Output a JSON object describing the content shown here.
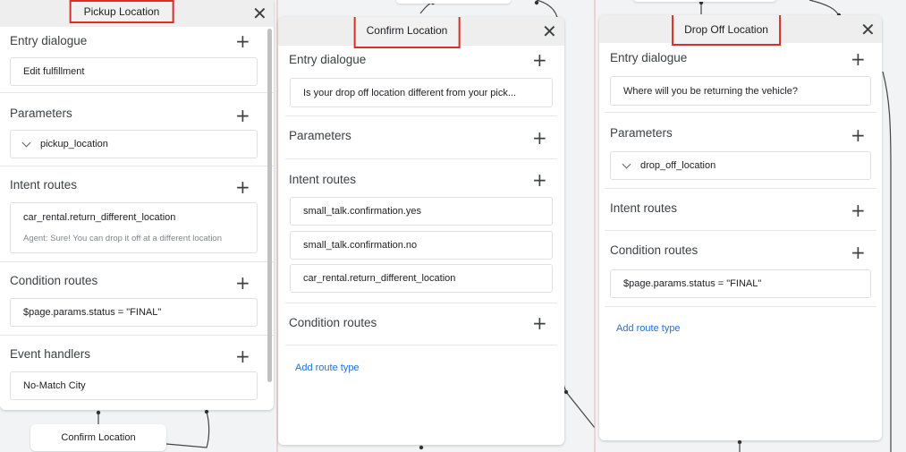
{
  "pickup": {
    "title": "Pickup Location",
    "entry_label": "Entry dialogue",
    "entry_item": "Edit fulfillment",
    "params_label": "Parameters",
    "param_item": "pickup_location",
    "intent_label": "Intent routes",
    "intent_item": "car_rental.return_different_location",
    "intent_sub": "Agent: Sure! You can drop it off at a different location",
    "cond_label": "Condition routes",
    "cond_item": "$page.params.status = \"FINAL\"",
    "event_label": "Event handlers",
    "event_item": "No-Match City"
  },
  "confirm": {
    "title": "Confirm Location",
    "entry_label": "Entry dialogue",
    "entry_item": "Is your drop off location different from your pick...",
    "params_label": "Parameters",
    "intent_label": "Intent routes",
    "intent_items": [
      "small_talk.confirmation.yes",
      "small_talk.confirmation.no",
      "car_rental.return_different_location"
    ],
    "cond_label": "Condition routes",
    "add_route": "Add route type"
  },
  "dropoff": {
    "title": "Drop Off Location",
    "entry_label": "Entry dialogue",
    "entry_item": "Where will you be returning the vehicle?",
    "params_label": "Parameters",
    "param_item": "drop_off_location",
    "intent_label": "Intent routes",
    "cond_label": "Condition routes",
    "cond_item": "$page.params.status = \"FINAL\"",
    "add_route": "Add route type"
  },
  "bottom_node": "Confirm Location",
  "icons": {
    "close": "close-icon",
    "add": "plus-icon",
    "expand": "chevron-down-icon"
  },
  "colors": {
    "highlight": "#d93025",
    "link": "#1a73e8"
  }
}
